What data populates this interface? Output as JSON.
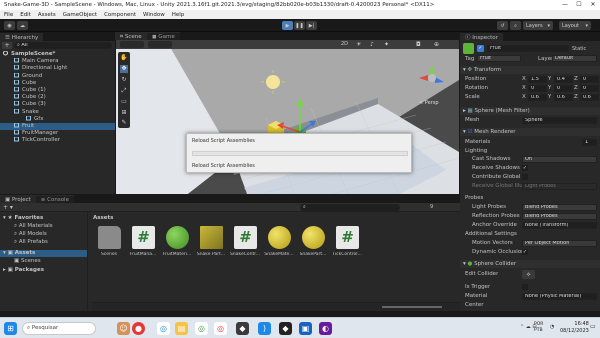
{
  "window": {
    "title": "Snake-Game-3D - SampleScene - Windows, Mac, Linux - Unity 2021.3.16f1.git.2021.3/evg/staging/82bb020e-b03b1330/draft-0.4200023 Personal* <DX11>",
    "controls": [
      "—",
      "☐",
      "✕"
    ]
  },
  "menu": [
    "File",
    "Edit",
    "Assets",
    "GameObject",
    "Component",
    "Window",
    "Help"
  ],
  "toolbar": {
    "play": "▶",
    "pause": "❚❚",
    "step": "▶|",
    "layers": "Layers",
    "layout": "Layout"
  },
  "hierarchy": {
    "tab": "Hierarchy",
    "search_placeholder": "All",
    "items": [
      {
        "label": "SampleScene*",
        "kind": "scene"
      },
      {
        "label": "Main Camera",
        "kind": "object"
      },
      {
        "label": "Directional Light",
        "kind": "object"
      },
      {
        "label": "Ground",
        "kind": "object"
      },
      {
        "label": "Cube",
        "kind": "object"
      },
      {
        "label": "Cube (1)",
        "kind": "object"
      },
      {
        "label": "Cube (2)",
        "kind": "object"
      },
      {
        "label": "Cube (3)",
        "kind": "object"
      },
      {
        "label": "Snake",
        "kind": "object"
      },
      {
        "label": "Gfx",
        "kind": "child"
      },
      {
        "label": "Fruit",
        "kind": "selected"
      },
      {
        "label": "FruitManager",
        "kind": "object"
      },
      {
        "label": "TickController",
        "kind": "object"
      }
    ]
  },
  "scene_view": {
    "tabs": [
      "Scene",
      "Game"
    ],
    "view_mode": "2D",
    "persp_label": "< Persp"
  },
  "modal": {
    "title": "Reload Script Assemblies",
    "status": "Reload Script Assemblies",
    "progress": 0
  },
  "inspector": {
    "tab": "Inspector",
    "object_name": "Fruit",
    "static_label": "Static",
    "tag_label": "Tag",
    "tag_value": "Fruit",
    "layer_label": "Layer",
    "layer_value": "Default",
    "transform": {
      "title": "Transform",
      "rows": [
        {
          "label": "Position",
          "x": "1.5",
          "y": "0.4",
          "z": "0"
        },
        {
          "label": "Rotation",
          "x": "0",
          "y": "0",
          "z": "0"
        },
        {
          "label": "Scale",
          "x": "0.6",
          "y": "0.6",
          "z": "0.6"
        }
      ]
    },
    "mesh_filter": {
      "title": "Sphere (Mesh Filter)",
      "mesh_label": "Mesh",
      "mesh_value": "Sphere"
    },
    "mesh_renderer": {
      "title": "Mesh Renderer",
      "materials": "Materials",
      "materials_count": "1",
      "lighting": "Lighting",
      "cast_shadows_label": "Cast Shadows",
      "cast_shadows_value": "On",
      "receive_shadows_label": "Receive Shadows",
      "contribute_gi_label": "Contribute Global Il",
      "receive_gi_label": "Receive Global Illu",
      "receive_gi_value": "Light Probes",
      "probes": "Probes",
      "light_probes_label": "Light Probes",
      "light_probes_value": "Blend Probes",
      "reflection_probes_label": "Reflection Probes",
      "reflection_probes_value": "Blend Probes",
      "anchor_override_label": "Anchor Override",
      "anchor_override_value": "None (Transform)",
      "additional": "Additional Settings",
      "motion_vectors_label": "Motion Vectors",
      "motion_vectors_value": "Per Object Motion",
      "dynamic_occlusion_label": "Dynamic Occlusion"
    },
    "sphere_collider": {
      "title": "Sphere Collider",
      "edit_collider": "Edit Collider",
      "is_trigger": "Is Trigger",
      "material_label": "Material",
      "material_value": "None (Physic Material)",
      "center_label": "Center"
    }
  },
  "project": {
    "tabs": [
      "Project",
      "Console"
    ],
    "favorites": "Favorites",
    "favorite_items": [
      "All Materials",
      "All Models",
      "All Prefabs"
    ],
    "assets_root": "Assets",
    "assets_children": [
      "Scenes"
    ],
    "packages": "Packages",
    "breadcrumb": "Assets",
    "count_badge": "9",
    "assets": [
      {
        "label": "Scenes",
        "type": "folder"
      },
      {
        "label": "FruitMana...",
        "type": "script"
      },
      {
        "label": "FruitMateri...",
        "type": "green-sphere"
      },
      {
        "label": "Snake Part...",
        "type": "olive-cube"
      },
      {
        "label": "SnakeContr...",
        "type": "script"
      },
      {
        "label": "SnakeMate...",
        "type": "yellow-sphere"
      },
      {
        "label": "SnakePart...",
        "type": "yellow-sphere"
      },
      {
        "label": "TickControl...",
        "type": "script"
      }
    ]
  },
  "taskbar": {
    "search": "Pesquisar",
    "lang": "POR",
    "lang2": "PTB",
    "time": "16:48",
    "date": "08/12/2023"
  },
  "colors": {
    "accent": "#2c5d87",
    "play": "#4c7fb8",
    "fruit_green": "#5eb33b",
    "snake_yellow": "#d7c12a"
  }
}
